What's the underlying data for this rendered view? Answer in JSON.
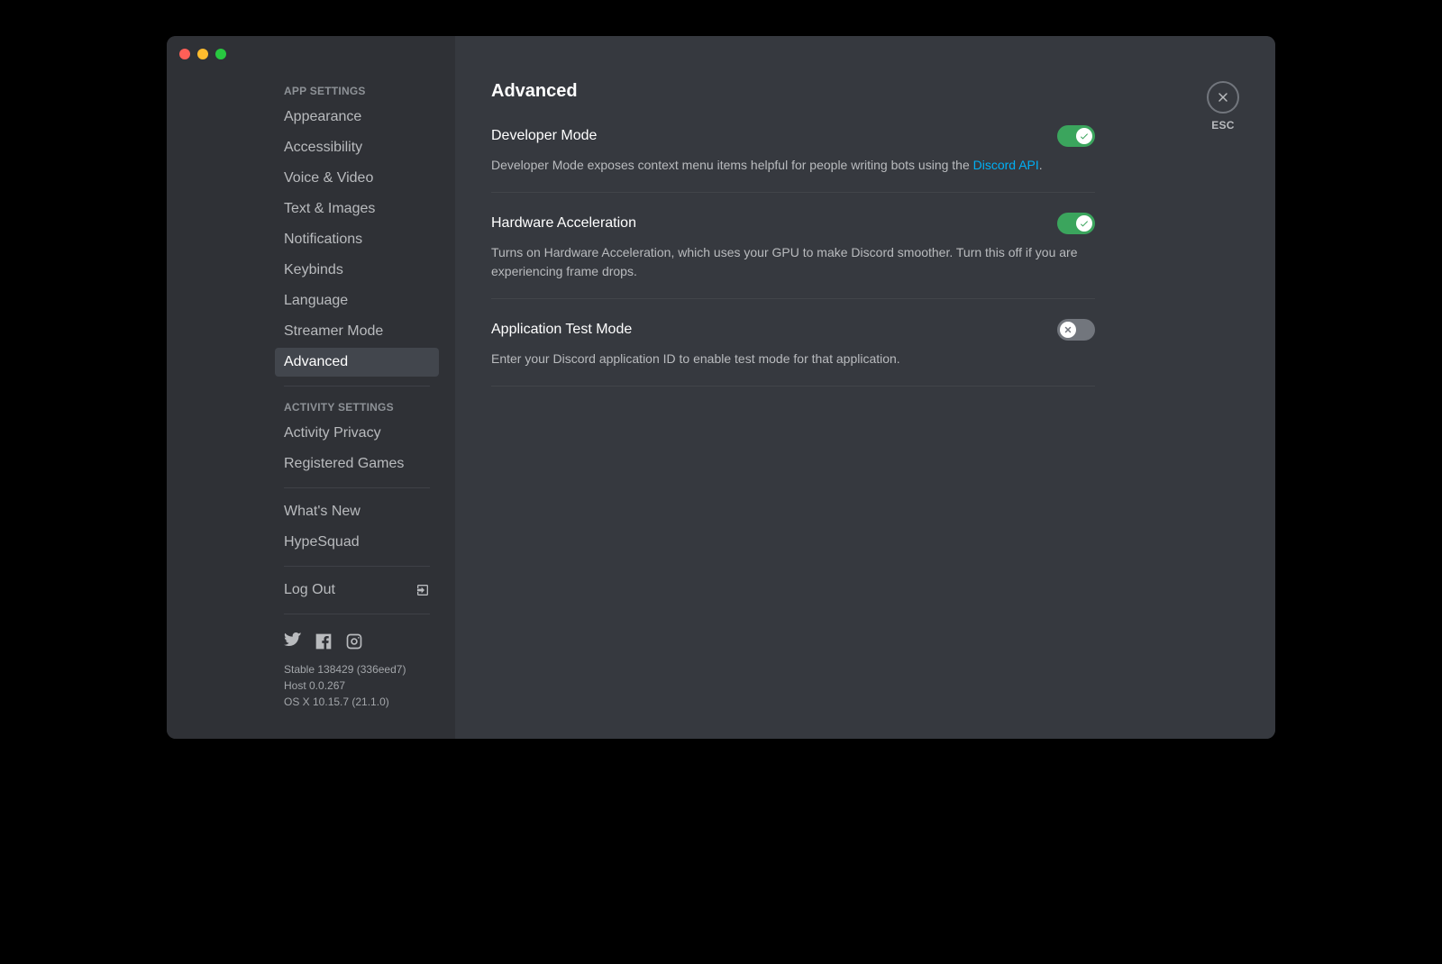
{
  "sidebar": {
    "section_app": "APP SETTINGS",
    "section_activity": "ACTIVITY SETTINGS",
    "items_app": [
      "Appearance",
      "Accessibility",
      "Voice & Video",
      "Text & Images",
      "Notifications",
      "Keybinds",
      "Language",
      "Streamer Mode",
      "Advanced"
    ],
    "items_activity": [
      "Activity Privacy",
      "Registered Games"
    ],
    "items_info": [
      "What's New",
      "HypeSquad"
    ],
    "logout": "Log Out",
    "version": {
      "line1": "Stable 138429 (336eed7)",
      "line2": "Host 0.0.267",
      "line3": "OS X 10.15.7 (21.1.0)"
    }
  },
  "main": {
    "title": "Advanced",
    "close_label": "ESC",
    "settings": {
      "dev": {
        "title": "Developer Mode",
        "desc_pre": "Developer Mode exposes context menu items helpful for people writing bots using the ",
        "link_text": "Discord API",
        "desc_post": ".",
        "enabled": true
      },
      "hw": {
        "title": "Hardware Acceleration",
        "desc": "Turns on Hardware Acceleration, which uses your GPU to make Discord smoother. Turn this off if you are experiencing frame drops.",
        "enabled": true
      },
      "test": {
        "title": "Application Test Mode",
        "desc": "Enter your Discord application ID to enable test mode for that application.",
        "enabled": false
      }
    }
  }
}
